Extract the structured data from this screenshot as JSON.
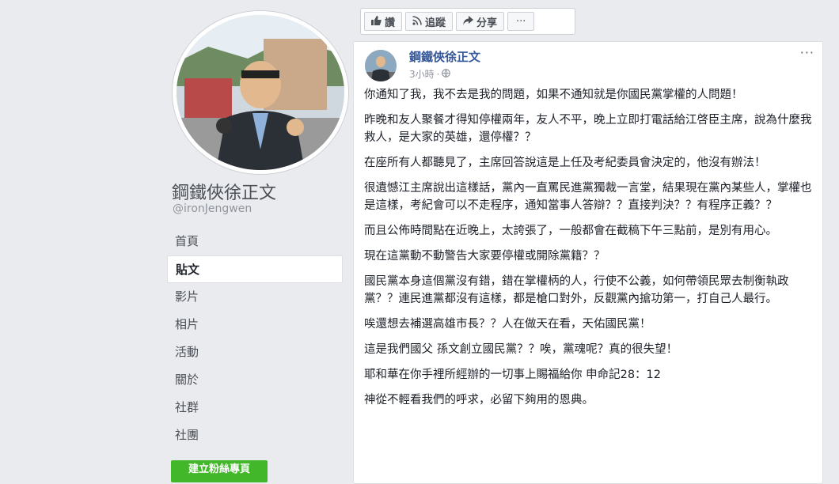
{
  "page": {
    "name": "鋼鐵俠徐正文",
    "handle": "@ironJengwen"
  },
  "nav": [
    {
      "label": "首頁",
      "active": false
    },
    {
      "label": "貼文",
      "active": true
    },
    {
      "label": "影片",
      "active": false
    },
    {
      "label": "相片",
      "active": false
    },
    {
      "label": "活動",
      "active": false
    },
    {
      "label": "關於",
      "active": false
    },
    {
      "label": "社群",
      "active": false
    },
    {
      "label": "社團",
      "active": false
    }
  ],
  "create_button_label": "建立粉絲專頁",
  "action_bar": {
    "like": {
      "label": "讚",
      "icon": "thumbs-up-icon"
    },
    "follow": {
      "label": "追蹤",
      "icon": "rss-icon"
    },
    "share": {
      "label": "分享",
      "icon": "share-arrow-icon"
    },
    "more": {
      "label": "···",
      "icon": "more-icon"
    }
  },
  "post": {
    "author": "鋼鐵俠徐正文",
    "time": "3小時",
    "privacy_icon": "globe-icon",
    "options": "···",
    "paragraphs": [
      "你通知了我，我不去是我的問題，如果不通知就是你國民黨掌權的人問題！",
      "昨晚和友人聚餐才得知停權兩年，友人不平，晚上立即打電話給江啓臣主席，說為什麼我救人，是大家的英雄，還停權？？",
      "在座所有人都聽見了，主席回答說這是上任及考紀委員會決定的，他沒有辦法！",
      "很遺憾江主席說出這樣話，黨內一直罵民進黨獨裁一言堂，結果現在黨內某些人，掌權也是這樣，考紀會可以不走程序，通知當事人答辯？？直接判決？？有程序正義？？",
      "而且公佈時間點在近晚上，太誇張了，一般都會在截稿下午三點前，是別有用心。",
      "現在這黨動不動警告大家要停權或開除黨籍？？",
      "國民黨本身這個黨沒有錯，錯在掌權柄的人，行使不公義，如何帶領民眾去制衡執政黨？？連民進黨都沒有這樣，都是槍口對外，反觀黨內搶功第一，打自己人最行。",
      "唉還想去補選高雄市長？？人在做天在看，天佑國民黨！",
      "這是我們國父 孫文創立國民黨？？唉，黨魂呢？真的很失望！",
      "耶和華在你手裡所經辦的一切事上賜福給你 申命記28：12",
      "神從不輕看我們的呼求，必留下夠用的恩典。"
    ]
  },
  "colors": {
    "background": "#e9ebee",
    "link": "#365899",
    "create_button": "#42b72a"
  }
}
